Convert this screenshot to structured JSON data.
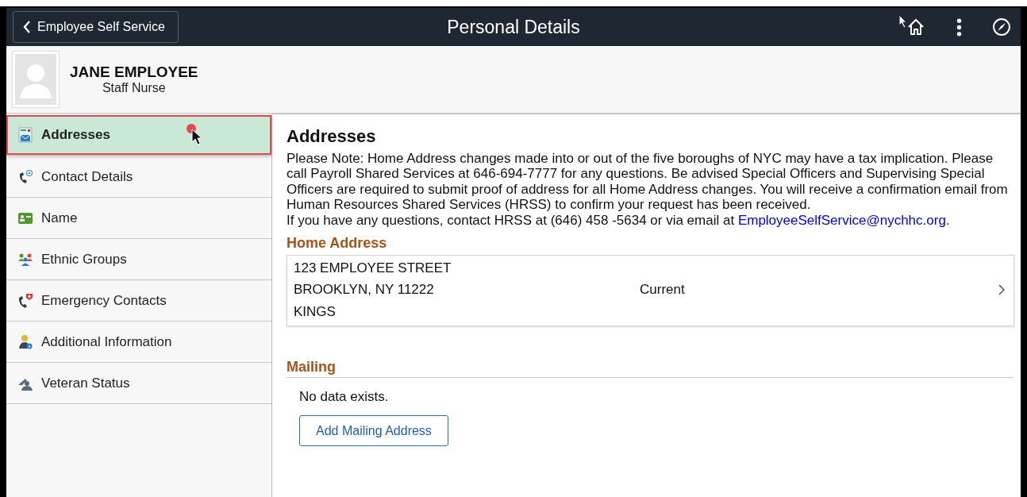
{
  "header": {
    "back_button": "Employee Self Service",
    "title": "Personal Details"
  },
  "profile": {
    "name": "JANE EMPLOYEE",
    "job_title": "Staff Nurse"
  },
  "sidebar": {
    "items": [
      {
        "label": "Addresses",
        "kind": "addresses",
        "selected": true
      },
      {
        "label": "Contact Details",
        "kind": "contact",
        "selected": false
      },
      {
        "label": "Name",
        "kind": "name",
        "selected": false
      },
      {
        "label": "Ethnic Groups",
        "kind": "groups",
        "selected": false
      },
      {
        "label": "Emergency Contacts",
        "kind": "emergency",
        "selected": false
      },
      {
        "label": "Additional Information",
        "kind": "info",
        "selected": false
      },
      {
        "label": "Veteran Status",
        "kind": "veteran",
        "selected": false
      }
    ]
  },
  "content": {
    "heading": "Addresses",
    "note": "Please Note: Home Address changes made into or out of the five boroughs of NYC may have a tax implication. Please call Payroll Shared Services at 646-694-7777 for any questions. Be advised Special Officers and Supervising Special Officers are required to submit proof of address for all Home Address changes. You will receive a confirmation email from Human Resources Shared Services (HRSS) to confirm your request has been received.",
    "contact": {
      "text": "If you have any questions, contact HRSS at (646) 458 -5634 or via email at ",
      "link": "EmployeeSelfService@nychhc.org",
      "after": "."
    },
    "home_address": {
      "heading": "Home Address",
      "lines": [
        "123 EMPLOYEE STREET",
        "BROOKLYN, NY 11222",
        "KINGS"
      ],
      "status": "Current"
    },
    "mailing": {
      "heading": "Mailing",
      "empty_text": "No data exists.",
      "button": "Add Mailing Address"
    }
  }
}
